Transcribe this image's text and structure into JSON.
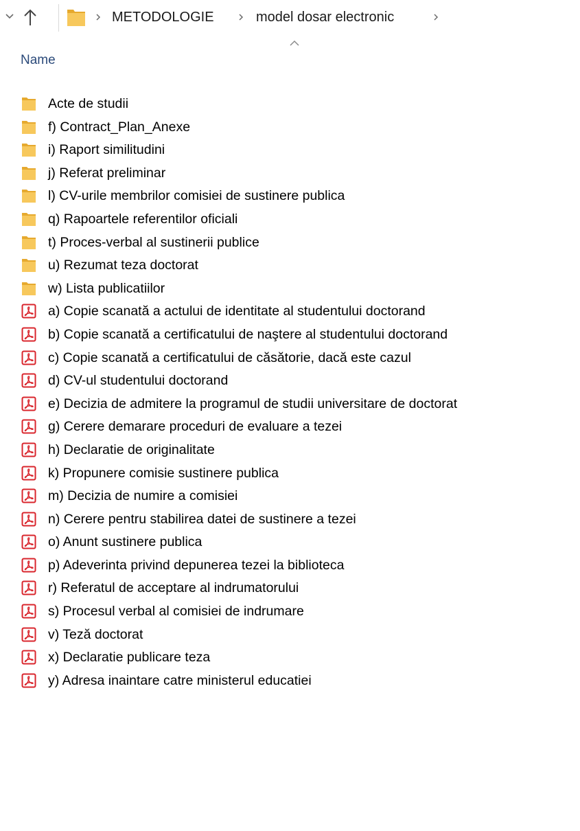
{
  "address_bar": {
    "breadcrumbs": [
      "METODOLOGIE",
      "model dosar electronic"
    ]
  },
  "header": {
    "name_column": "Name"
  },
  "colors": {
    "folder": "#f7c85c",
    "pdf": "#d9252c",
    "header_text": "#2b4a7a"
  },
  "items": [
    {
      "type": "folder",
      "icon": "folder-icon",
      "name": "Acte de studii"
    },
    {
      "type": "folder",
      "icon": "folder-icon",
      "name": "f) Contract_Plan_Anexe"
    },
    {
      "type": "folder",
      "icon": "folder-icon",
      "name": "i) Raport similitudini"
    },
    {
      "type": "folder",
      "icon": "folder-icon",
      "name": "j) Referat preliminar"
    },
    {
      "type": "folder",
      "icon": "folder-icon",
      "name": "l) CV-urile membrilor comisiei de sustinere publica"
    },
    {
      "type": "folder",
      "icon": "folder-icon",
      "name": "q) Rapoartele referentilor oficiali"
    },
    {
      "type": "folder",
      "icon": "folder-icon",
      "name": "t) Proces-verbal al sustinerii publice"
    },
    {
      "type": "folder",
      "icon": "folder-icon",
      "name": "u) Rezumat teza doctorat"
    },
    {
      "type": "folder",
      "icon": "folder-icon",
      "name": "w) Lista publicatiilor"
    },
    {
      "type": "pdf",
      "icon": "pdf-icon",
      "name": "a) Copie scanată a actului de identitate al studentului doctorand"
    },
    {
      "type": "pdf",
      "icon": "pdf-icon",
      "name": "b) Copie scanată a certificatului de naştere al studentului doctorand"
    },
    {
      "type": "pdf",
      "icon": "pdf-icon",
      "name": "c) Copie scanată a certificatului de căsătorie, dacă este cazul"
    },
    {
      "type": "pdf",
      "icon": "pdf-icon",
      "name": "d) CV-ul studentului doctorand"
    },
    {
      "type": "pdf",
      "icon": "pdf-icon",
      "name": "e) Decizia de admitere la programul de studii universitare de doctorat"
    },
    {
      "type": "pdf",
      "icon": "pdf-icon",
      "name": "g) Cerere demarare proceduri de evaluare a tezei"
    },
    {
      "type": "pdf",
      "icon": "pdf-icon",
      "name": "h) Declaratie de originalitate"
    },
    {
      "type": "pdf",
      "icon": "pdf-icon",
      "name": "k) Propunere comisie sustinere publica"
    },
    {
      "type": "pdf",
      "icon": "pdf-icon",
      "name": "m) Decizia de numire a comisiei"
    },
    {
      "type": "pdf",
      "icon": "pdf-icon",
      "name": "n) Cerere pentru stabilirea datei de sustinere a tezei"
    },
    {
      "type": "pdf",
      "icon": "pdf-icon",
      "name": "o) Anunt sustinere publica"
    },
    {
      "type": "pdf",
      "icon": "pdf-icon",
      "name": "p) Adeverinta privind depunerea tezei la biblioteca"
    },
    {
      "type": "pdf",
      "icon": "pdf-icon",
      "name": "r) Referatul de acceptare al indrumatorului"
    },
    {
      "type": "pdf",
      "icon": "pdf-icon",
      "name": "s) Procesul verbal al comisiei de indrumare"
    },
    {
      "type": "pdf",
      "icon": "pdf-icon",
      "name": "v) Teză doctorat"
    },
    {
      "type": "pdf",
      "icon": "pdf-icon",
      "name": "x) Declaratie publicare teza"
    },
    {
      "type": "pdf",
      "icon": "pdf-icon",
      "name": "y) Adresa inaintare catre ministerul educatiei"
    }
  ]
}
